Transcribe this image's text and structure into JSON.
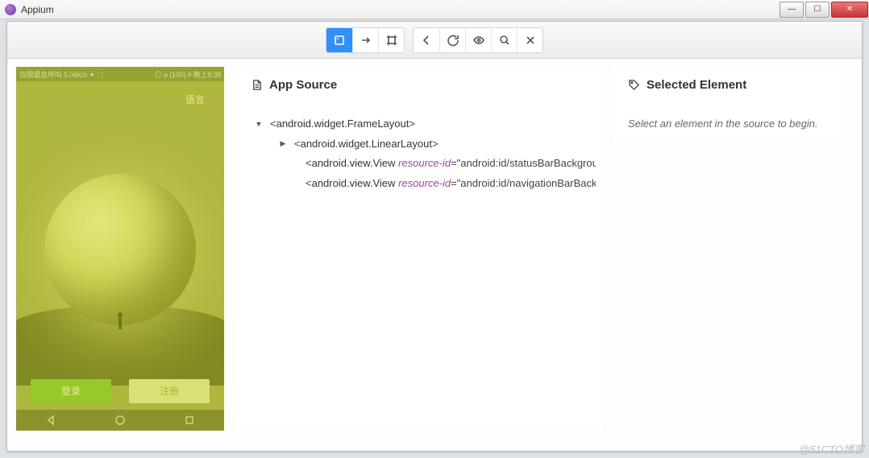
{
  "window": {
    "title": "Appium"
  },
  "toolbar": {
    "left_group": [
      "select-mode",
      "swipe-mode",
      "tap-mode"
    ],
    "right_group": [
      "back",
      "refresh",
      "eye",
      "search",
      "close"
    ]
  },
  "device": {
    "status_left": "仅限紧急呼叫  5.04K/s ✦ ⬚",
    "status_right": "◎ ⌀ (100) # 晚上8:38",
    "language_label": "语言",
    "login_label": "登录",
    "register_label": "注册"
  },
  "app_source": {
    "title": "App Source",
    "tree": [
      {
        "level": 0,
        "expanded": true,
        "tag": "android.widget.FrameLayout",
        "attr": null,
        "val": null
      },
      {
        "level": 1,
        "expanded": false,
        "tag": "android.widget.LinearLayout",
        "attr": null,
        "val": null
      },
      {
        "level": 1,
        "expanded": null,
        "tag": "android.view.View",
        "attr": "resource-id",
        "val": "android:id/statusBarBackground"
      },
      {
        "level": 1,
        "expanded": null,
        "tag": "android.view.View",
        "attr": "resource-id",
        "val": "android:id/navigationBarBackground"
      }
    ]
  },
  "selected": {
    "title": "Selected Element",
    "hint": "Select an element in the source to begin."
  },
  "watermark": "@51CTO博客"
}
